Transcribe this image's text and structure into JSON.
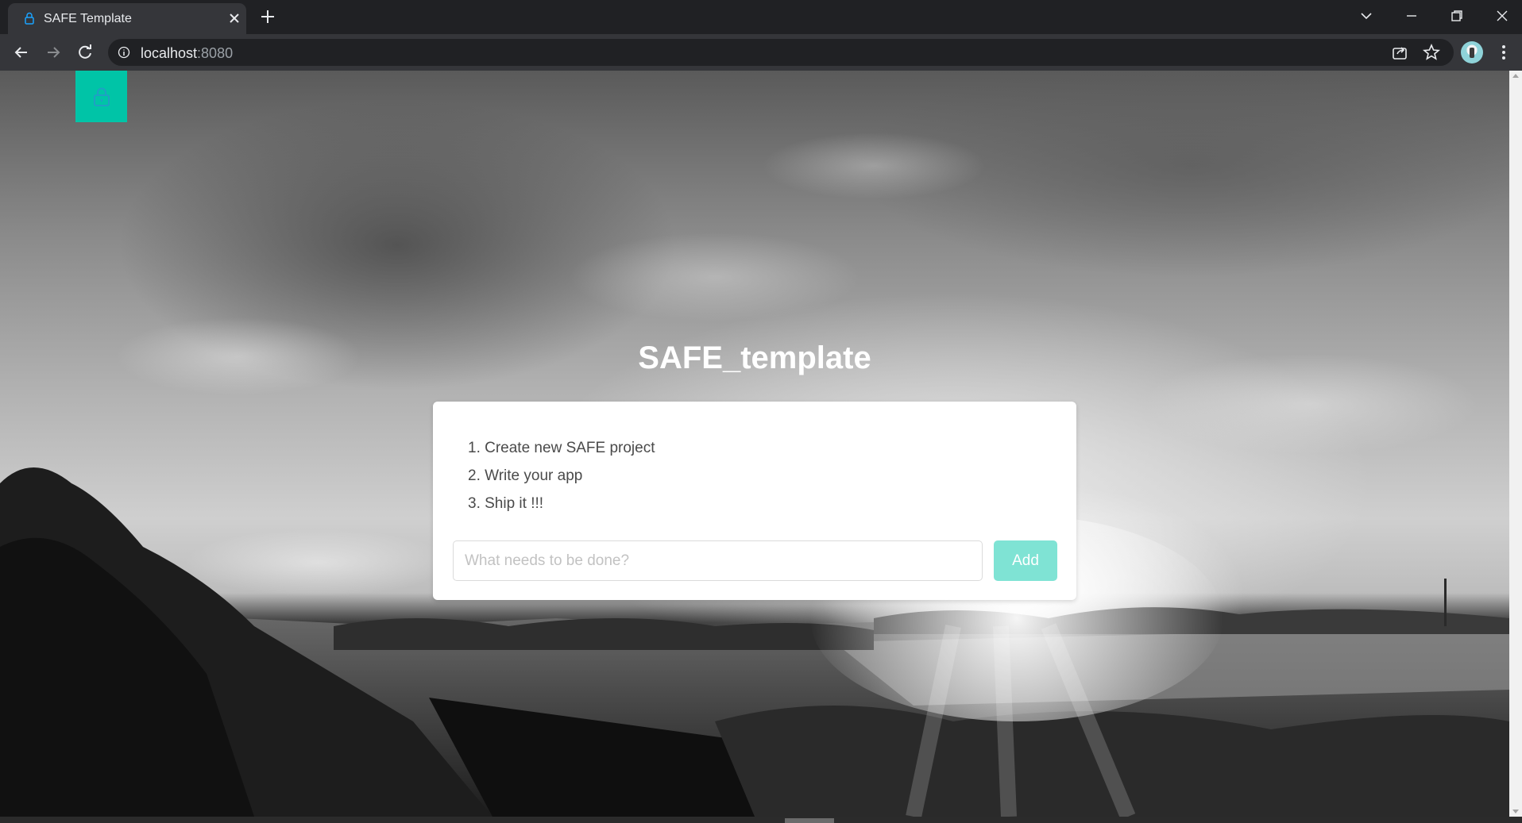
{
  "browser": {
    "tab_title": "SAFE Template",
    "url_host": "localhost",
    "url_port": ":8080"
  },
  "page": {
    "title": "SAFE_template",
    "steps": [
      "1. Create new SAFE project",
      "2. Write your app",
      "3. Ship it !!!"
    ],
    "todo_placeholder": "What needs to be done?",
    "add_label": "Add"
  },
  "colors": {
    "accent": "#00c4a7",
    "add_button": "#7fe3d4"
  }
}
